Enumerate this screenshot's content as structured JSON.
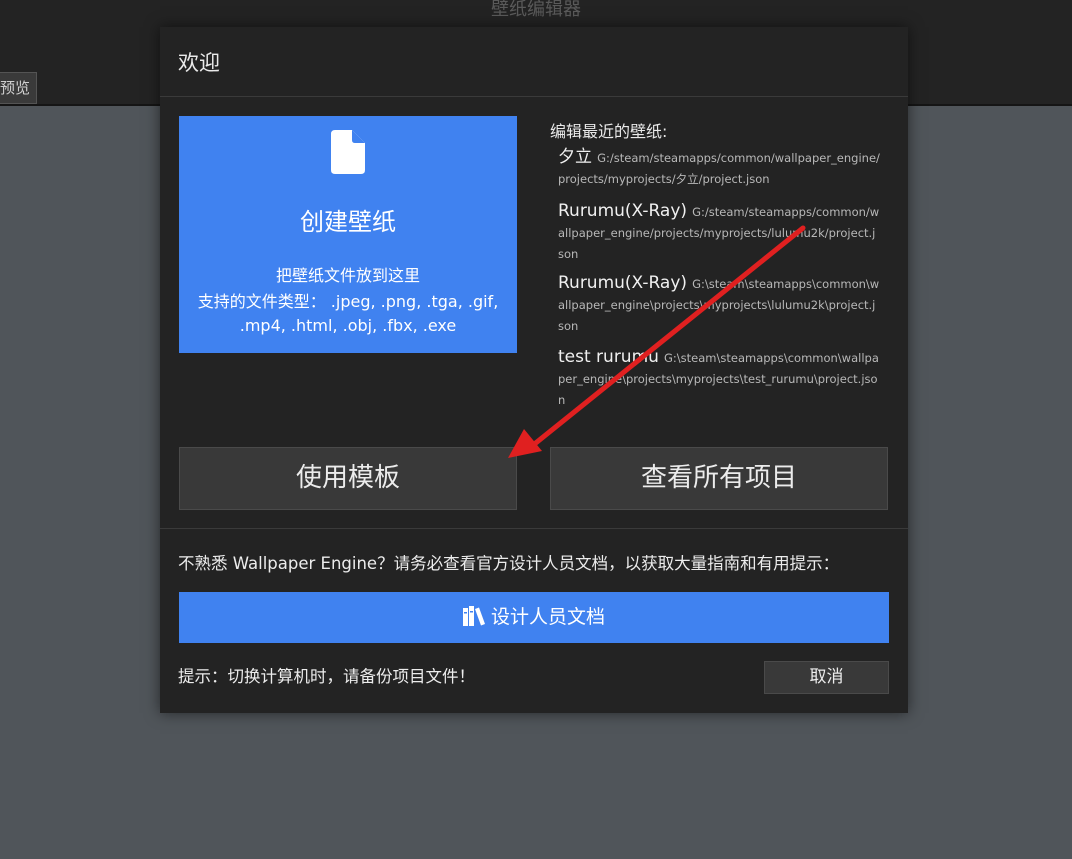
{
  "app": {
    "title": "壁纸编辑器",
    "preview_tab": "预览"
  },
  "dialog": {
    "title": "欢迎",
    "create": {
      "icon": "file-icon",
      "title": "创建壁纸",
      "hint": "把壁纸文件放到这里",
      "types": "支持的文件类型： .jpeg, .png, .tga, .gif, .mp4, .html, .obj, .fbx, .exe"
    },
    "recent": {
      "title": "编辑最近的壁纸:",
      "items": [
        {
          "name": "夕立",
          "path": "G:/steam/steamapps/common/wallpaper_engine/projects/myprojects/夕立/project.json"
        },
        {
          "name": "Rurumu(X-Ray)",
          "path": "G:/steam/steamapps/common/wallpaper_engine/projects/myprojects/lulumu2k/project.json"
        },
        {
          "name": "Rurumu(X-Ray)",
          "path": "G:\\steam\\steamapps\\common\\wallpaper_engine\\projects\\myprojects\\lulumu2k\\project.json"
        },
        {
          "name": "test rurumu",
          "path": "G:\\steam\\steamapps\\common\\wallpaper_engine\\projects\\myprojects\\test_rurumu\\project.json"
        }
      ]
    },
    "use_template_label": "使用模板",
    "view_all_label": "查看所有项目",
    "notice": "不熟悉 Wallpaper Engine？请务必查看官方设计人员文档，以获取大量指南和有用提示：",
    "docs_button": {
      "icon": "books-icon",
      "label": "设计人员文档"
    },
    "tip": "提示：切换计算机时，请备份项目文件！",
    "cancel_label": "取消"
  },
  "colors": {
    "accent_blue": "#4082f0",
    "dialog_bg": "#232323",
    "button_bg": "#393939",
    "page_bg": "#50555a",
    "annotation_arrow": "#e02020"
  }
}
